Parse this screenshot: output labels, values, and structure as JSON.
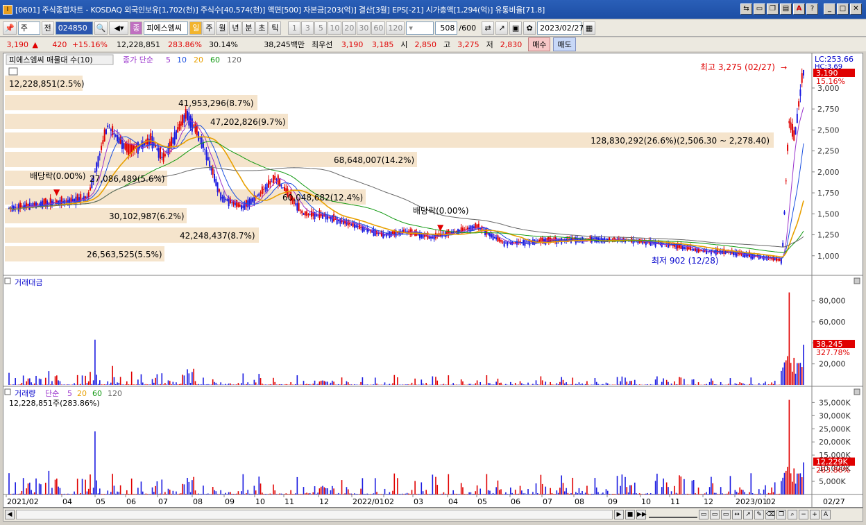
{
  "window": {
    "title": "[0601] 주식종합차트 - KOSDAQ 외국인보유[1,702(천)] 주식수[40,574(천)] 액면[500] 자본금[203(억)] 결산[3월] EPS[-21] 시가총액[1,294(억)] 유통비율[71.8]",
    "app_icon": "I"
  },
  "toolbar": {
    "type_select": "주",
    "prefix": "전",
    "stock_code": "024850",
    "stock_name": "피에스엠씨",
    "period_buttons": [
      "일",
      "주",
      "월",
      "년",
      "분",
      "초",
      "틱"
    ],
    "selected_period": "일",
    "interval_buttons": [
      "1",
      "3",
      "5",
      "10",
      "20",
      "30",
      "60",
      "120"
    ],
    "count": "508",
    "count_max": "/600",
    "date": "2023/02/27"
  },
  "quote": {
    "price": "3,190",
    "arrow": "▲",
    "change": "420",
    "change_pct": "+15.16%",
    "volume": "12,228,851",
    "volume_ratio": "283.86%",
    "turnover": "30.14%",
    "amount": "38,245백만",
    "pref_label": "최우선",
    "ask": "3,190",
    "bid": "3,185",
    "open_label": "시",
    "open": "2,850",
    "high_label": "고",
    "high": "3,275",
    "low_label": "저",
    "low": "2,830",
    "buy": "매수",
    "sell": "매도"
  },
  "price_panel": {
    "legend_title": "피에스엠씨 매물대 수(10)",
    "legend_ma_label": "종가 단순",
    "ma_periods": [
      "5",
      "10",
      "20",
      "60",
      "120"
    ],
    "ma_colors": [
      "#9932cc",
      "#1a4fe0",
      "#e8a000",
      "#119911",
      "#666666"
    ],
    "lc_label": "LC:253.66",
    "hc_label": "HC:3.69",
    "last_price_tag": "3,190",
    "last_pct_tag": "15.16%",
    "high_annotation": "최고 3,275 (02/27)",
    "low_annotation": "최저 902 (12/28)",
    "dividend_label": "배당락(0.00%)",
    "y_ticks": [
      "3,000",
      "2,750",
      "2,500",
      "2,250",
      "2,000",
      "1,750",
      "1,500",
      "1,250",
      "1,000"
    ],
    "volume_profile": [
      {
        "label": "12,228,851(2.5%)"
      },
      {
        "label": "41,953,296(8.7%)"
      },
      {
        "label": "47,202,826(9.7%)"
      },
      {
        "label": "128,830,292(26.6%)(2,506.30 ~ 2,278.40)"
      },
      {
        "label": "68,648,007(14.2%)"
      },
      {
        "label": "27,086,489(5.6%)"
      },
      {
        "label": "60,048,682(12.4%)"
      },
      {
        "label": "30,102,987(6.2%)"
      },
      {
        "label": "42,248,437(8.7%)"
      },
      {
        "label": "26,563,525(5.5%)"
      }
    ]
  },
  "amount_panel": {
    "title": "거래대금",
    "y_ticks": [
      "80,000",
      "60,000",
      "40,000",
      "20,000"
    ],
    "last_tag": "38,245",
    "pct_tag": "327.78%"
  },
  "volume_panel": {
    "title": "거래량",
    "legend_ma_label": "단순",
    "ma_periods": [
      "5",
      "20",
      "60",
      "120"
    ],
    "ma_colors": [
      "#9932cc",
      "#e8a000",
      "#119911",
      "#666666"
    ],
    "subtitle": "12,228,851주(283.86%)",
    "y_ticks": [
      "35,000K",
      "30,000K",
      "25,000K",
      "20,000K",
      "15,000K",
      "10,000K",
      "5,000K"
    ],
    "last_tag": "12,229K",
    "pct_tag": "283.86%"
  },
  "x_axis": {
    "labels": [
      "2021/02",
      "04",
      "05",
      "06",
      "07",
      "08",
      "09",
      "10",
      "11",
      "12",
      "2022/01",
      "02",
      "03",
      "04",
      "05",
      "06",
      "07",
      "08",
      "09",
      "10",
      "11",
      "12",
      "2023/01",
      "02"
    ],
    "right_label": "02/27"
  },
  "chart_data": {
    "type": "candlestick",
    "x_range": [
      "2021/02",
      "2023/02/27"
    ],
    "y_range": [
      750,
      3275
    ],
    "close_path": [
      [
        "2021/02",
        1560
      ],
      [
        "2021/03",
        1620
      ],
      [
        "2021/04",
        1650
      ],
      [
        "2021/04b",
        1700
      ],
      [
        "2021/05",
        2550
      ],
      [
        "2021/05b",
        2250
      ],
      [
        "2021/06",
        2380
      ],
      [
        "2021/06b",
        2150
      ],
      [
        "2021/07",
        2700
      ],
      [
        "2021/07b",
        2350
      ],
      [
        "2021/08",
        1700
      ],
      [
        "2021/08b",
        1580
      ],
      [
        "2021/09",
        1720
      ],
      [
        "2021/09b",
        1930
      ],
      [
        "2021/10",
        1500
      ],
      [
        "2021/10b",
        1480
      ],
      [
        "2021/11",
        1360
      ],
      [
        "2021/12",
        1250
      ],
      [
        "2022/01",
        1290
      ],
      [
        "2022/02",
        1220
      ],
      [
        "2022/02b",
        1350
      ],
      [
        "2022/03",
        1150
      ],
      [
        "2022/04",
        1180
      ],
      [
        "2022/05",
        1200
      ],
      [
        "2022/06",
        1180
      ],
      [
        "2022/07",
        1140
      ],
      [
        "2022/08",
        1060
      ],
      [
        "2022/09",
        1040
      ],
      [
        "2022/10",
        1000
      ],
      [
        "2022/11",
        980
      ],
      [
        "2022/12",
        980
      ],
      [
        "2023/01",
        940
      ],
      [
        "2023/02a",
        2600
      ],
      [
        "2023/02b",
        2400
      ],
      [
        "2023/02/27",
        3190
      ]
    ],
    "high": {
      "date": "02/27",
      "value": 3275
    },
    "low": {
      "date": "12/28",
      "value": 902
    }
  }
}
